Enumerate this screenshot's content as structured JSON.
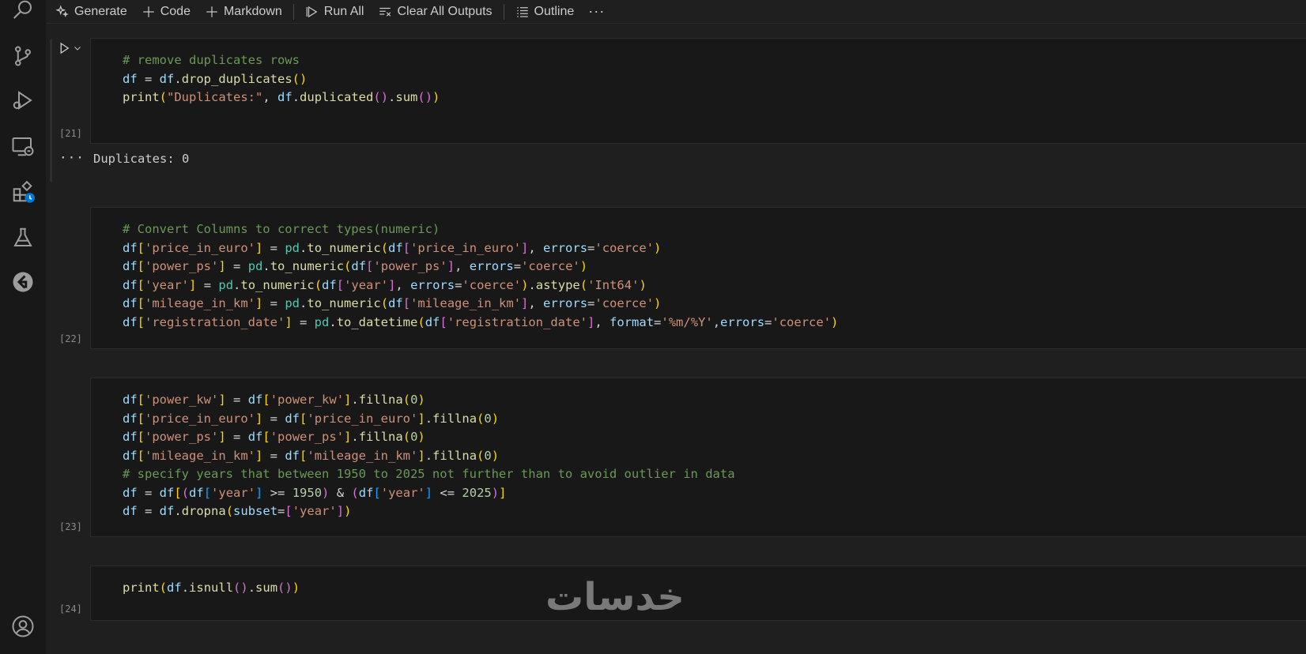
{
  "toolbar": {
    "generate_label": "Generate",
    "code_label": "Code",
    "markdown_label": "Markdown",
    "run_all_label": "Run All",
    "clear_outputs_label": "Clear All Outputs",
    "outline_label": "Outline",
    "more_label": "···"
  },
  "activity_bar": {
    "icons": [
      "search-icon",
      "source-control-icon",
      "run-debug-icon",
      "remote-explorer-icon",
      "extensions-icon",
      "testing-icon",
      "remote-icon",
      "account-icon"
    ]
  },
  "cells": [
    {
      "exec_count": "[21]",
      "lines": [
        "# remove duplicates rows",
        "df = df.drop_duplicates()",
        "print(\"Duplicates:\", df.duplicated().sum())"
      ]
    },
    {
      "exec_count": "[22]",
      "lines": [
        "# Convert Columns to correct types(numeric)",
        "df['price_in_euro'] = pd.to_numeric(df['price_in_euro'], errors='coerce')",
        "df['power_ps'] = pd.to_numeric(df['power_ps'], errors='coerce')",
        "df['year'] = pd.to_numeric(df['year'], errors='coerce').astype('Int64')",
        "df['mileage_in_km'] = pd.to_numeric(df['mileage_in_km'], errors='coerce')",
        "df['registration_date'] = pd.to_datetime(df['registration_date'], format='%m/%Y',errors='coerce')"
      ]
    },
    {
      "exec_count": "[23]",
      "lines": [
        "df['power_kw'] = df['power_kw'].fillna(0)",
        "df['price_in_euro'] = df['price_in_euro'].fillna(0)",
        "df['power_ps'] = df['power_ps'].fillna(0)",
        "df['mileage_in_km'] = df['mileage_in_km'].fillna(0)",
        "# specify years that between 1950 to 2025 not further than to avoid outlier in data",
        "df = df[(df['year'] >= 1950) & (df['year'] <= 2025)]",
        "df = df.dropna(subset=['year'])"
      ]
    },
    {
      "exec_count": "[24]",
      "lines": [
        "print(df.isnull().sum())"
      ]
    }
  ],
  "output_21": {
    "dots": "···",
    "text": "Duplicates: 0"
  },
  "watermark": "خدسات"
}
